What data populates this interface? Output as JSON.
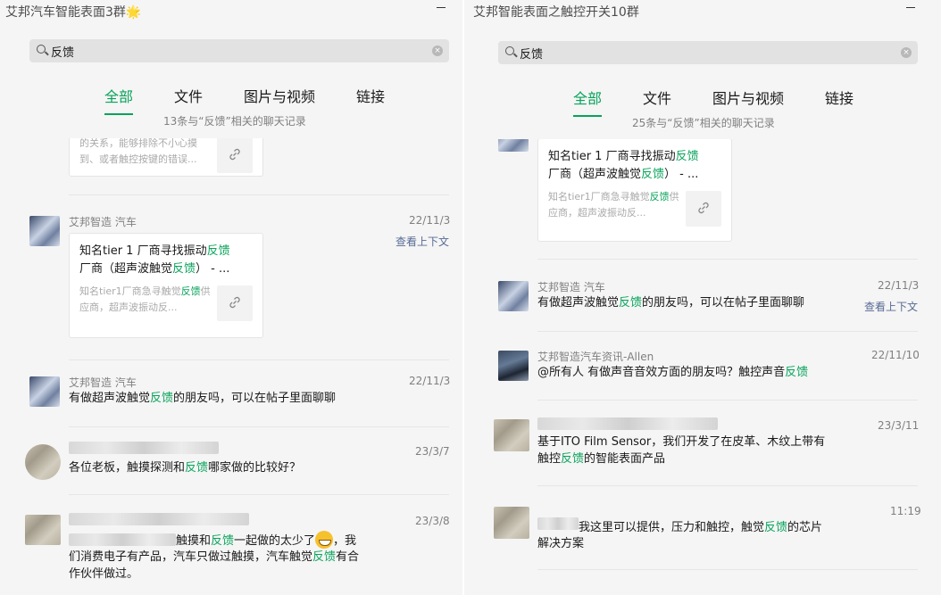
{
  "left": {
    "title": "艾邦汽车智能表面3群🌟",
    "search": {
      "value": "反馈"
    },
    "tabs": [
      "全部",
      "文件",
      "图片与视频",
      "链接"
    ],
    "count": "13条与“反馈”相关的聊天记录",
    "items": [
      {
        "type": "card-partial",
        "desc": "的关系，能够排除不小心摸到、或者触控按键的错误..."
      },
      {
        "type": "card",
        "sender": "艾邦智造 汽车",
        "time": "22/11/3",
        "context": "查看上下文",
        "title_pre": "知名tier 1 厂商寻找振动",
        "title_hl": "反馈",
        "title_mid": "厂商（超声波触觉",
        "title_hl2": "反馈",
        "title_post": "） - ...",
        "desc_pre": "知名tier1厂商急寻触觉",
        "desc_hl": "反馈",
        "desc_post": "供应商，超声波振动反..."
      },
      {
        "type": "text",
        "sender": "艾邦智造 汽车",
        "time": "22/11/3",
        "pre": "有做超声波触觉",
        "hl": "反馈",
        "post": "的朋友吗，可以在帖子里面聊聊"
      },
      {
        "type": "text",
        "sender": "",
        "time": "23/3/7",
        "pre": "各位老板，触摸探测和",
        "hl": "反馈",
        "post": "哪家做的比较好？"
      },
      {
        "type": "text",
        "sender": "",
        "time": "23/3/8",
        "l1_pre": "触摸和",
        "l1_hl": "反馈",
        "l1_post": "一起做的太少了",
        "l1_end": "，我",
        "l2_pre": "们消费电子有产品，汽车只做过触摸，汽车触觉",
        "l2_hl": "反馈",
        "l2_post": "有合",
        "l3": "作伙伴做过。"
      }
    ]
  },
  "right": {
    "title": "艾邦智能表面之触控开关10群",
    "search": {
      "value": "反馈"
    },
    "tabs": [
      "全部",
      "文件",
      "图片与视频",
      "链接"
    ],
    "count": "25条与“反馈”相关的聊天记录",
    "items": [
      {
        "type": "card",
        "title_pre": "知名tier 1 厂商寻找振动",
        "title_hl": "反馈",
        "title_mid": "厂商（超声波触觉",
        "title_hl2": "反馈",
        "title_post": "） - ...",
        "desc_pre": "知名tier1厂商急寻触觉",
        "desc_hl": "反馈",
        "desc_post": "供应商，超声波振动反..."
      },
      {
        "type": "text",
        "sender": "艾邦智造 汽车",
        "time": "22/11/3",
        "context": "查看上下文",
        "pre": "有做超声波触觉",
        "hl": "反馈",
        "post": "的朋友吗，可以在帖子里面聊聊"
      },
      {
        "type": "text",
        "sender": "艾邦智造汽车资讯-Allen",
        "time": "22/11/10",
        "pre": "@所有人 有做声音音效方面的朋友吗？触控声音",
        "hl": "反馈",
        "post": ""
      },
      {
        "type": "text",
        "sender": "",
        "time": "23/3/11",
        "l1": "基于ITO Film Sensor，我们开发了在皮革、木纹上带有",
        "l2_pre": "触控",
        "l2_hl": "反馈",
        "l2_post": "的智能表面产品"
      },
      {
        "type": "text",
        "sender": "",
        "time": "11:19",
        "l1_pre": "我这里可以提供，压力和触控，触觉",
        "l1_hl": "反馈",
        "l1_post": "的芯片",
        "l2": "解决方案"
      }
    ]
  }
}
